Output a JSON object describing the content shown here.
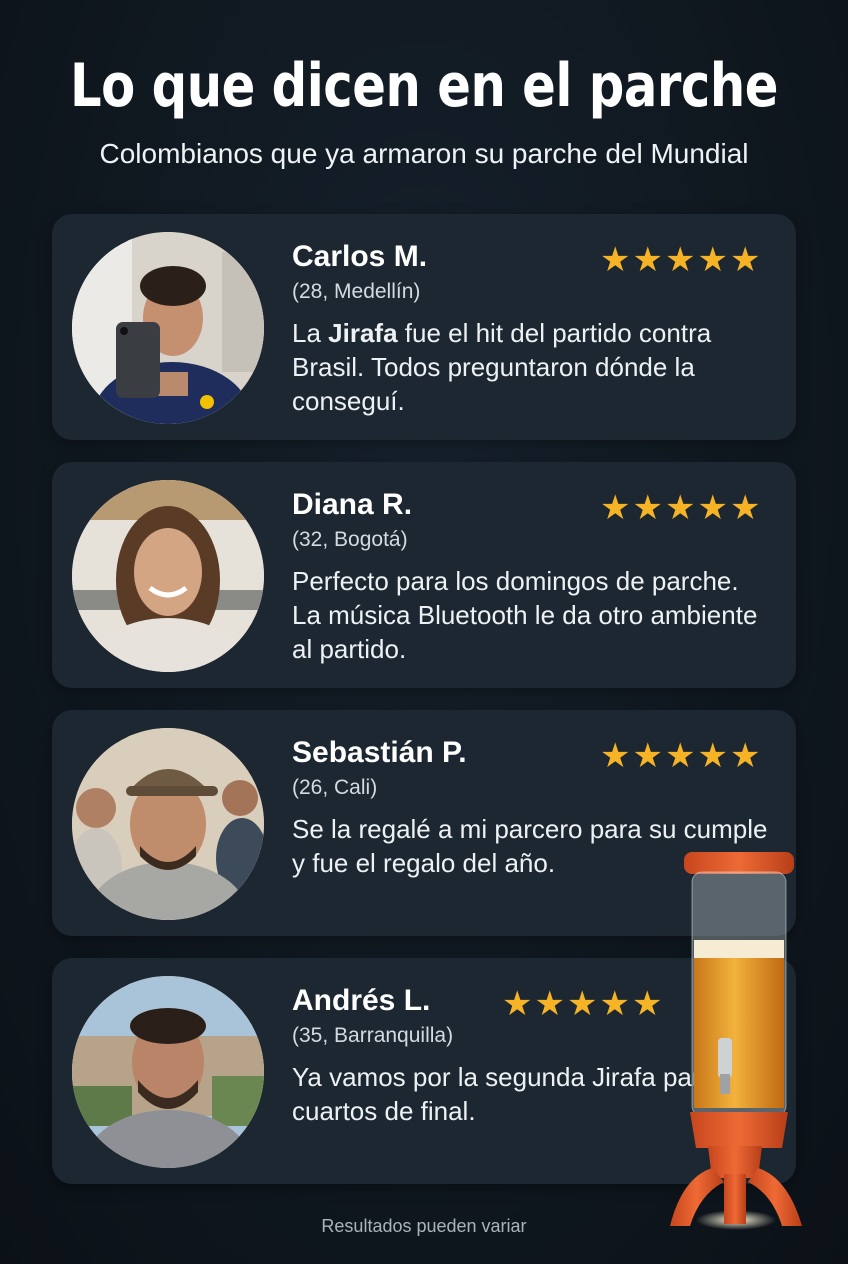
{
  "header": {
    "title": "Lo que dicen en el parche",
    "subtitle": "Colombianos que ya armaron su parche del Mundial"
  },
  "colors": {
    "star": "#f5b325",
    "card": "#1c2731",
    "background": "#101820"
  },
  "reviews": [
    {
      "name": "Carlos M.",
      "meta": "(28, Medellín)",
      "quote_pre": "La ",
      "quote_bold": "Jirafa",
      "quote_post": " fue el hit del partido contra Brasil. Todos preguntaron dónde la conseguí.",
      "rating": 5,
      "avatar": "avatar-man-selfie-colombia-jersey"
    },
    {
      "name": "Diana R.",
      "meta": "(32, Bogotá)",
      "quote_pre": "Perfecto para los domingos de parche. La música Bluetooth le da otro ambiente al partido.",
      "quote_bold": "",
      "quote_post": "",
      "rating": 5,
      "avatar": "avatar-woman-kitchen"
    },
    {
      "name": "Sebastián P.",
      "meta": "(26, Cali)",
      "quote_pre": "Se la regalé a mi parcero para su cumple y fue el regalo del año.",
      "quote_bold": "",
      "quote_post": "",
      "rating": 5,
      "avatar": "avatar-man-cap-friends"
    },
    {
      "name": "Andrés L.",
      "meta": "(35, Barranquilla)",
      "quote_pre": "Ya vamos por la segunda Jirafa para los cuartos de final.",
      "quote_bold": "",
      "quote_post": "",
      "rating": 5,
      "avatar": "avatar-man-balcony"
    }
  ],
  "product": {
    "icon": "beer-tower-dispenser-icon"
  },
  "footer": {
    "disclaimer": "Resultados pueden variar"
  }
}
